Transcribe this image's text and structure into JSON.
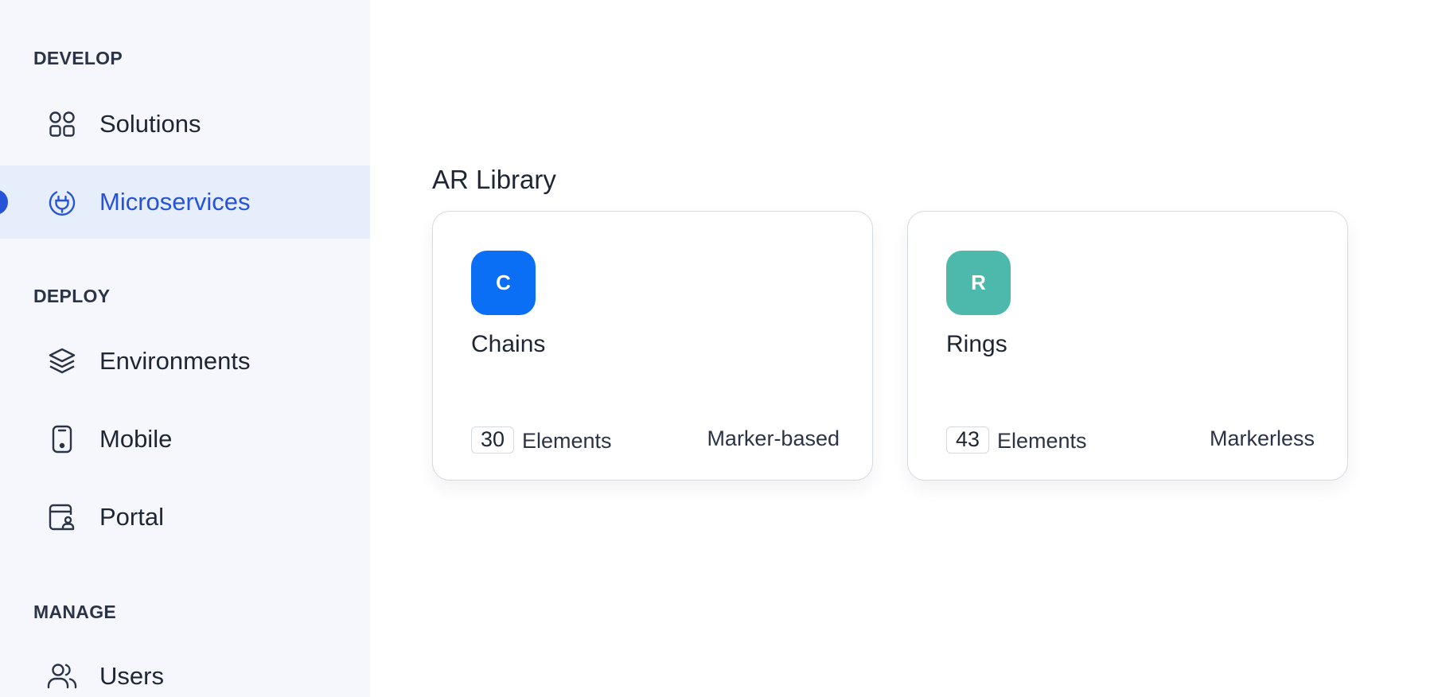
{
  "sidebar": {
    "sections": {
      "develop": "DEVELOP",
      "deploy": "DEPLOY",
      "manage": "MANAGE"
    },
    "items": {
      "solutions": {
        "label": "Solutions",
        "icon": "grid-circles-icon"
      },
      "microservices": {
        "label": "Microservices",
        "icon": "plug-icon",
        "active": true
      },
      "environments": {
        "label": "Environments",
        "icon": "layers-icon"
      },
      "mobile": {
        "label": "Mobile",
        "icon": "mobile-icon"
      },
      "portal": {
        "label": "Portal",
        "icon": "portal-icon"
      },
      "users": {
        "label": "Users",
        "icon": "users-icon"
      }
    }
  },
  "main": {
    "title": "AR Library",
    "cards": [
      {
        "initial": "C",
        "name": "Chains",
        "count": "30",
        "count_label": "Elements",
        "type": "Marker-based",
        "color": "#0a6ff5"
      },
      {
        "initial": "R",
        "name": "Rings",
        "count": "43",
        "count_label": "Elements",
        "type": "Markerless",
        "color": "#4db8ac"
      }
    ]
  },
  "colors": {
    "sidebar_bg": "#f5f7fc",
    "active_bg": "#e6edfb",
    "accent": "#2753d8"
  }
}
